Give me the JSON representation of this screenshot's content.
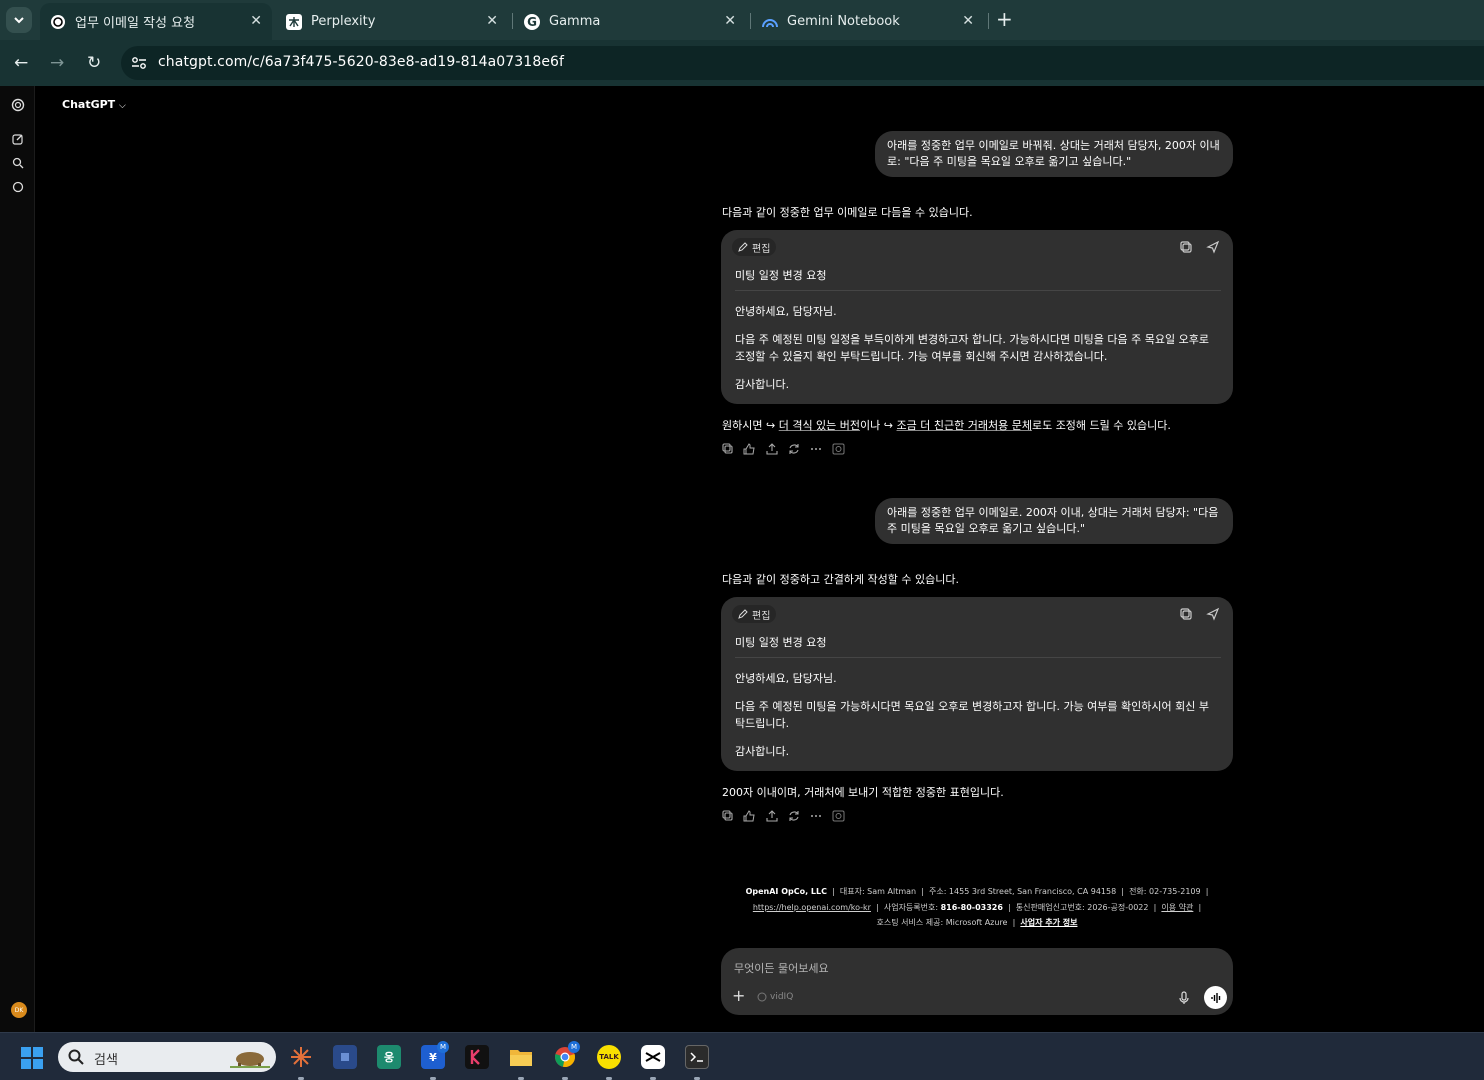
{
  "browser": {
    "tabs": [
      {
        "title": "업무 이메일 작성 요청",
        "active": true,
        "icon": "chatgpt-icon"
      },
      {
        "title": "Perplexity",
        "active": false,
        "icon": "perplexity-icon"
      },
      {
        "title": "Gamma",
        "active": false,
        "icon": "gamma-icon"
      },
      {
        "title": "Gemini Notebook",
        "active": false,
        "icon": "gemini-notebook-icon"
      }
    ],
    "url": "chatgpt.com/c/6a73f475-5620-83e8-ad19-814a07318e6f",
    "theme_colors": {
      "tabbar": "#1f3a3a",
      "toolbar": "#183333"
    }
  },
  "app": {
    "model_selector": "ChatGPT"
  },
  "conversation": [
    {
      "user": "아래를 정중한 업무 이메일로 바꿔줘. 상대는 거래처 담당자, 200자 이내로: \"다음 주 미팅을 목요일 오후로 옮기고 싶습니다.\"",
      "intro": "다음과 같이 정중한 업무 이메일로 다듬을 수 있습니다.",
      "card": {
        "edit_label": "편집",
        "subject": "미팅 일정 변경 요청",
        "greeting": "안녕하세요, 담당자님.",
        "body": "다음 주 예정된 미팅 일정을 부득이하게 변경하고자 합니다. 가능하시다면 미팅을 다음 주 목요일 오후로 조정할 수 있을지 확인 부탁드립니다. 가능 여부를 회신해 주시면 감사하겠습니다.",
        "closing": "감사합니다."
      },
      "follow_up": {
        "prefix": "원하시면 ",
        "arrow": "↪",
        "link1": "더 격식 있는 버전",
        "middle": "이나 ",
        "link2": "조금 더 친근한 거래처용 문체",
        "suffix": "로도 조정해 드릴 수 있습니다."
      }
    },
    {
      "user": "아래를 정중한 업무 이메일로. 200자 이내, 상대는 거래처 담당자: \"다음 주 미팅을 목요일 오후로 옮기고 싶습니다.\"",
      "intro": "다음과 같이 정중하고 간결하게 작성할 수 있습니다.",
      "card": {
        "edit_label": "편집",
        "subject": "미팅 일정 변경 요청",
        "greeting": "안녕하세요, 담당자님.",
        "body": "다음 주 예정된 미팅을 가능하시다면 목요일 오후로 변경하고자 합니다. 가능 여부를 확인하시어 회신 부탁드립니다.",
        "closing": "감사합니다."
      },
      "follow_up_text": "200자 이내이며, 거래처에 보내기 적합한 정중한 표현입니다."
    }
  ],
  "footer": {
    "company": "OpenAI OpCo, LLC",
    "ceo": "대표자: Sam Altman",
    "address": "주소: 1455 3rd Street, San Francisco, CA 94158",
    "phone": "전화: 02-735-2109",
    "help_url": "https://help.openai.com/ko-kr",
    "biz_label": "사업자등록번호: ",
    "biz_no": "816-80-03326",
    "ecommerce": "통신판매업신고번호: 2026-공정-0022",
    "terms": "이용 약관",
    "hosting": "호스팅 서비스 제공: Microsoft Azure",
    "biz_info": "사업자 추가 정보"
  },
  "composer": {
    "placeholder": "무엇이든 물어보세요",
    "vidiq": "vidIQ"
  },
  "user_avatar": "DK",
  "taskbar": {
    "search_label": "검색",
    "app_labels": {
      "stock": "웅",
      "yen": "¥",
      "kakao": "TALK",
      "badge1": "M",
      "badge2": "M"
    }
  }
}
